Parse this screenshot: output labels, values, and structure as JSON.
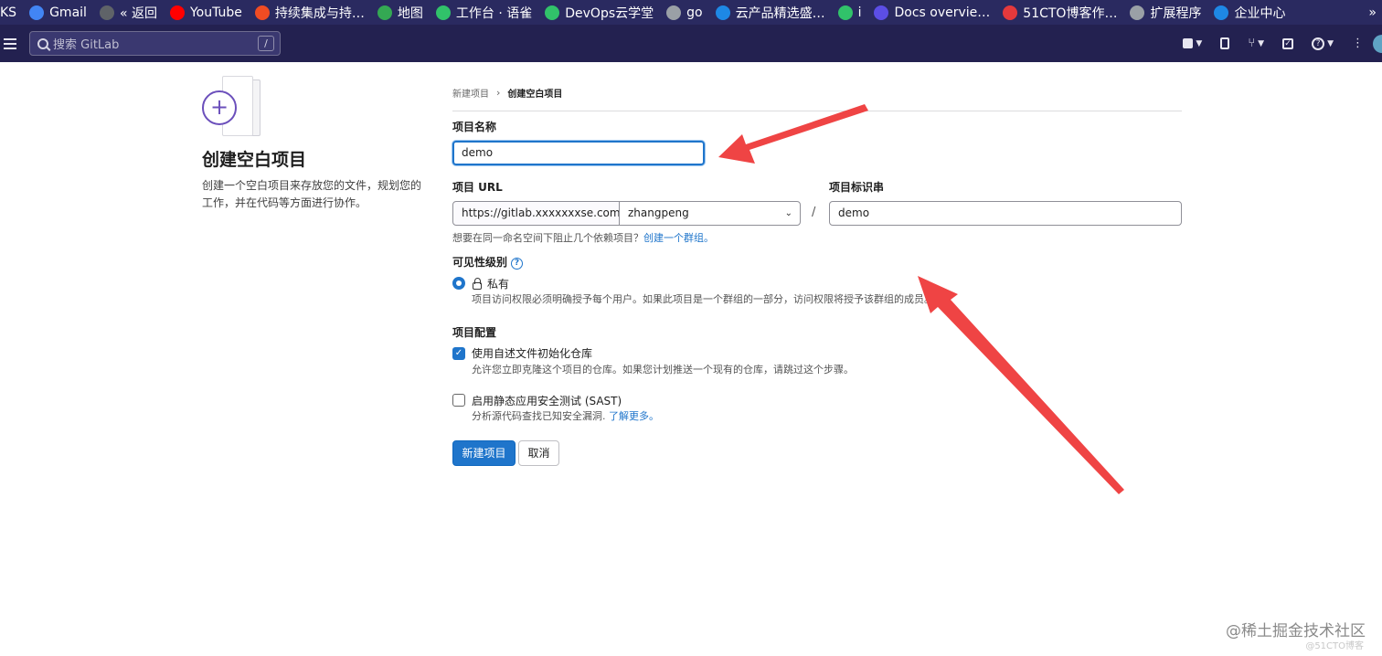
{
  "bookmarks": [
    {
      "label": "KS",
      "icon": "bookmark-icon",
      "color": "#2a2a60"
    },
    {
      "label": "Gmail",
      "icon": "google-icon",
      "color": "#4285f4"
    },
    {
      "label": "« 返回",
      "icon": "globe-icon",
      "color": "#5f6368"
    },
    {
      "label": "YouTube",
      "icon": "youtube-icon",
      "color": "#ff0000"
    },
    {
      "label": "持续集成与持…",
      "icon": "c-icon",
      "color": "#f04c23"
    },
    {
      "label": "地图",
      "icon": "map-icon",
      "color": "#34a853"
    },
    {
      "label": "工作台 · 语雀",
      "icon": "yuque-icon",
      "color": "#31c26a"
    },
    {
      "label": "DevOps云学堂",
      "icon": "devops-icon",
      "color": "#31c26a"
    },
    {
      "label": "go",
      "icon": "folder-icon",
      "color": "#9aa0a6"
    },
    {
      "label": "云产品精选盛…",
      "icon": "cloud-icon",
      "color": "#1e88e5"
    },
    {
      "label": "i",
      "icon": "swoosh-icon",
      "color": "#31c26a"
    },
    {
      "label": "Docs overvie…",
      "icon": "terraform-icon",
      "color": "#5c4ee5"
    },
    {
      "label": "51CTO博客作…",
      "icon": "51cto-icon",
      "color": "#e4393c"
    },
    {
      "label": "扩展程序",
      "icon": "puzzle-icon",
      "color": "#9aa0a6"
    },
    {
      "label": "企业中心",
      "icon": "cloud-icon",
      "color": "#1e88e5"
    }
  ],
  "bookmarks_more": "»",
  "header": {
    "search_placeholder": "搜索 GitLab",
    "search_shortcut": "/"
  },
  "left": {
    "title": "创建空白项目",
    "description": "创建一个空白项目来存放您的文件，规划您的工作，并在代码等方面进行协作。"
  },
  "breadcrumb": {
    "parent": "新建项目",
    "separator": "›",
    "current": "创建空白项目"
  },
  "form": {
    "project_name_label": "项目名称",
    "project_name_value": "demo",
    "project_url_label": "项目 URL",
    "project_url_prefix": "https://gitlab.xxxxxxxse.com/",
    "namespace_value": "zhangpeng",
    "slug_separator": "/",
    "project_slug_label": "项目标识串",
    "project_slug_value": "demo",
    "hint_text": "想要在同一命名空间下阻止几个依赖项目？",
    "hint_link": "创建一个群组。",
    "visibility_label": "可见性级别",
    "visibility_help_icon": "?",
    "visibility_option": "私有",
    "visibility_option_help": "项目访问权限必须明确授予每个用户。如果此项目是一个群组的一部分，访问权限将授予该群组的成员。",
    "config_label": "项目配置",
    "readme_label": "使用自述文件初始化仓库",
    "readme_checked": true,
    "readme_help": "允许您立即克隆这个项目的仓库。如果您计划推送一个现有的仓库，请跳过这个步骤。",
    "sast_label": "启用静态应用安全测试 (SAST)",
    "sast_checked": false,
    "sast_help": "分析源代码查找已知安全漏洞.",
    "sast_link": "了解更多。",
    "create_button": "新建项目",
    "cancel_button": "取消"
  },
  "annotation_color": "#ef4444",
  "watermark": "@稀土掘金技术社区",
  "watermark_small": "@51CTO博客"
}
